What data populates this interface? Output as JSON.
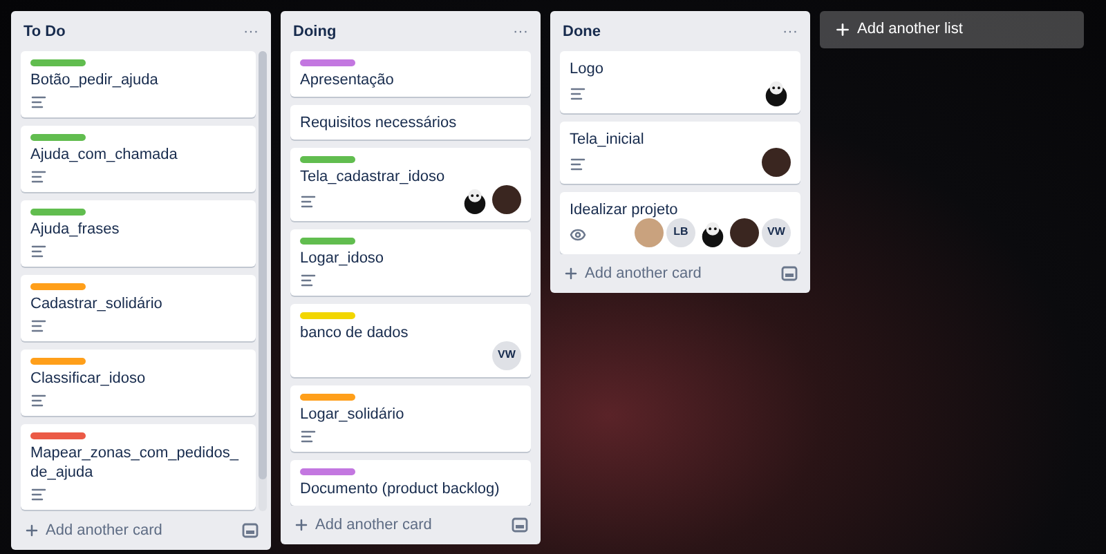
{
  "lists": [
    {
      "title": "To Do",
      "menu": "···",
      "scrollable": true,
      "add_card": "Add another card",
      "cards": [
        {
          "color": "#61bd4f",
          "title": "Botão_pedir_ajuda",
          "description": true
        },
        {
          "color": "#61bd4f",
          "title": "Ajuda_com_chamada",
          "description": true
        },
        {
          "color": "#61bd4f",
          "title": "Ajuda_frases",
          "description": true
        },
        {
          "color": "#ff9f1a",
          "title": "Cadastrar_solidário",
          "description": true
        },
        {
          "color": "#ff9f1a",
          "title": "Classificar_idoso",
          "description": true
        },
        {
          "color": "#eb5a46",
          "title": "Mapear_zonas_com_pedidos_de_ajuda",
          "description": true
        }
      ]
    },
    {
      "title": "Doing",
      "menu": "···",
      "scrollable": false,
      "add_card": "Add another card",
      "cards": [
        {
          "color": "#c377e0",
          "title": "Apresentação",
          "description": false
        },
        {
          "title": "Requisitos necessários",
          "description": false
        },
        {
          "color": "#61bd4f",
          "title": "Tela_cadastrar_idoso",
          "description": true,
          "members": [
            {
              "kind": "mascot"
            },
            {
              "kind": "photo"
            }
          ]
        },
        {
          "color": "#61bd4f",
          "title": "Logar_idoso",
          "description": true
        },
        {
          "color": "#f2d600",
          "title": "banco de dados",
          "description": false,
          "members": [
            {
              "kind": "initials",
              "text": "VW"
            }
          ]
        },
        {
          "color": "#ff9f1a",
          "title": "Logar_solidário",
          "description": true
        },
        {
          "color": "#c377e0",
          "title": "Documento (product backlog)",
          "description": false
        }
      ]
    },
    {
      "title": "Done",
      "menu": "···",
      "scrollable": false,
      "add_card": "Add another card",
      "cards": [
        {
          "title": "Logo",
          "description": true,
          "members": [
            {
              "kind": "mascot"
            }
          ]
        },
        {
          "title": "Tela_inicial",
          "description": true,
          "members": [
            {
              "kind": "photo"
            }
          ]
        },
        {
          "title": "Idealizar projeto",
          "description": false,
          "watching": true,
          "members": [
            {
              "kind": "photo-light"
            },
            {
              "kind": "initials",
              "text": "LB"
            },
            {
              "kind": "mascot"
            },
            {
              "kind": "photo"
            },
            {
              "kind": "initials",
              "text": "VW"
            }
          ]
        }
      ]
    }
  ],
  "add_list": "Add another list"
}
